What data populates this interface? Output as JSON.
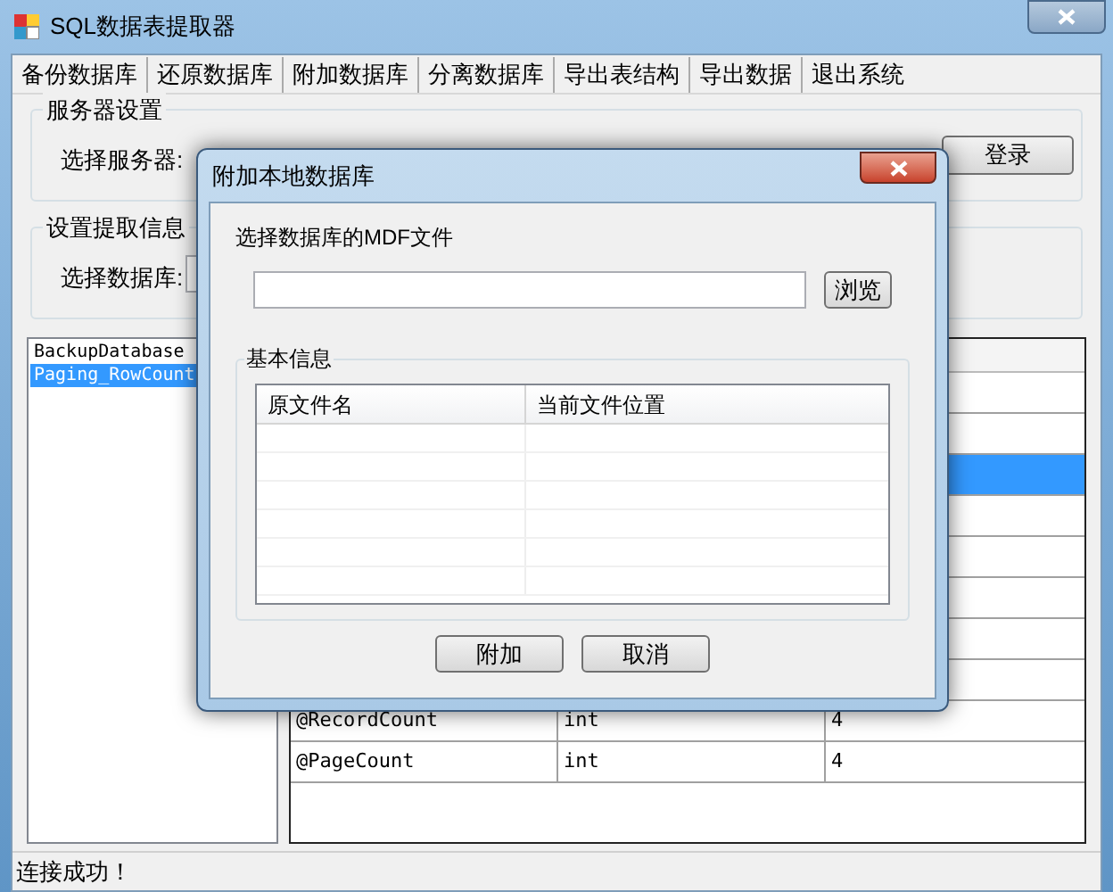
{
  "window": {
    "title": "SQL数据表提取器"
  },
  "menu": [
    {
      "label": "备份数据库"
    },
    {
      "label": "还原数据库"
    },
    {
      "label": "附加数据库"
    },
    {
      "label": "分离数据库"
    },
    {
      "label": "导出表结构"
    },
    {
      "label": "导出数据"
    },
    {
      "label": "退出系统"
    }
  ],
  "server_group": {
    "title": "服务器设置",
    "label": "选择服务器:",
    "login_button": "登录"
  },
  "extract_group": {
    "title": "设置提取信息",
    "label": "选择数据库:"
  },
  "procedures": [
    {
      "name": "BackupDatabase",
      "selected": false
    },
    {
      "name": "Paging_RowCount",
      "selected": true
    }
  ],
  "grid": {
    "rows": [
      {
        "selected": false
      },
      {
        "selected": false
      },
      {
        "selected": true
      },
      {
        "selected": false
      },
      {
        "selected": false
      },
      {
        "selected": false
      },
      {
        "selected": false
      },
      {
        "selected": false
      },
      {
        "selected": false,
        "cells": [
          "@RecordCount",
          "int",
          "4"
        ]
      },
      {
        "selected": false,
        "cells": [
          "@PageCount",
          "int",
          "4"
        ]
      }
    ]
  },
  "status_bar": "连接成功！",
  "dialog": {
    "title": "附加本地数据库",
    "file_label": "选择数据库的MDF文件",
    "browse_button": "浏览",
    "group_title": "基本信息",
    "columns": [
      "原文件名",
      "当前文件位置"
    ],
    "buttons": [
      "附加",
      "取消"
    ]
  }
}
